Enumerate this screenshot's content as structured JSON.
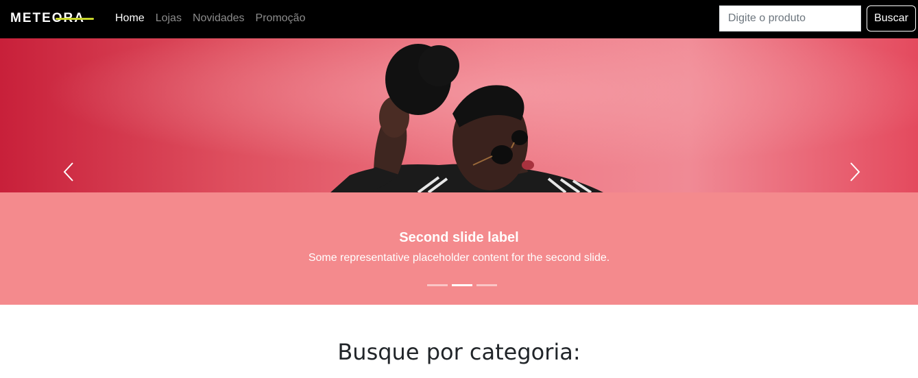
{
  "navbar": {
    "logo": "METEORA",
    "links": [
      {
        "label": "Home",
        "active": true
      },
      {
        "label": "Lojas",
        "active": false
      },
      {
        "label": "Novidades",
        "active": false
      },
      {
        "label": "Promoção",
        "active": false
      }
    ],
    "search": {
      "placeholder": "Digite o produto",
      "value": ""
    },
    "search_button": "Buscar"
  },
  "carousel": {
    "caption_title": "Second slide label",
    "caption_text": "Some representative placeholder content for the second slide.",
    "indicators": 3,
    "active_index": 1,
    "prev_icon": "chevron-left-icon",
    "next_icon": "chevron-right-icon"
  },
  "section": {
    "title": "Busque por categoria:"
  },
  "colors": {
    "navbar_bg": "#000000",
    "hero_bg": "#e85a6a",
    "caption_bg": "#f48a8d",
    "logo_accent": "#c8d62a"
  }
}
